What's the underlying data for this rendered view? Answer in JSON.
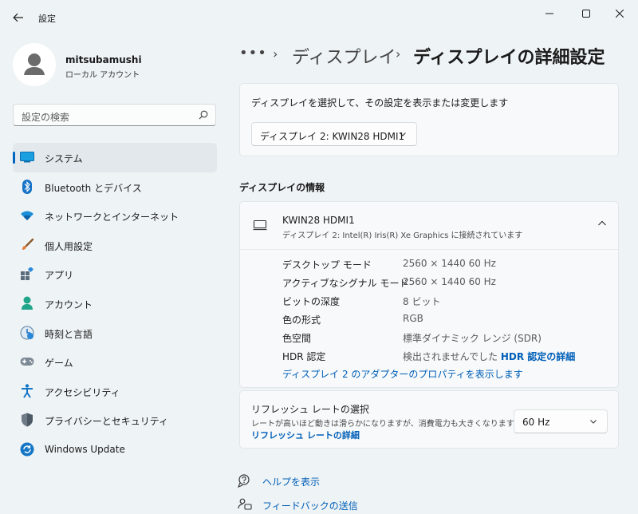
{
  "window": {
    "title": "設定"
  },
  "colors": {
    "accent": "#0067c0",
    "link": "#005fb8",
    "background": "#eef3f5",
    "card": "#f7f9fa"
  },
  "profile": {
    "name": "mitsubamushi",
    "account_type": "ローカル アカウント"
  },
  "search": {
    "placeholder": "設定の検索"
  },
  "sidebar": {
    "items": [
      {
        "label": "システム",
        "icon": "system-icon",
        "active": true
      },
      {
        "label": "Bluetooth とデバイス",
        "icon": "bluetooth-icon"
      },
      {
        "label": "ネットワークとインターネット",
        "icon": "wifi-icon"
      },
      {
        "label": "個人用設定",
        "icon": "brush-icon"
      },
      {
        "label": "アプリ",
        "icon": "apps-icon"
      },
      {
        "label": "アカウント",
        "icon": "account-icon"
      },
      {
        "label": "時刻と言語",
        "icon": "time-language-icon"
      },
      {
        "label": "ゲーム",
        "icon": "gamepad-icon"
      },
      {
        "label": "アクセシビリティ",
        "icon": "accessibility-icon"
      },
      {
        "label": "プライバシーとセキュリティ",
        "icon": "shield-icon"
      },
      {
        "label": "Windows Update",
        "icon": "update-icon"
      }
    ]
  },
  "breadcrumb": {
    "ellipsis": "•••",
    "parent": "ディスプレイ",
    "current": "ディスプレイの詳細設定"
  },
  "display_select": {
    "label": "ディスプレイを選択して、その設定を表示または変更します",
    "selected": "ディスプレイ 2: KWIN28 HDMI1"
  },
  "display_info": {
    "section_title": "ディスプレイの情報",
    "name": "KWIN28 HDMI1",
    "connection": "ディスプレイ 2: Intel(R) Iris(R) Xe Graphics に接続されています",
    "rows": [
      {
        "label": "デスクトップ モード",
        "value": "2560 × 1440 60 Hz"
      },
      {
        "label": "アクティブなシグナル モード",
        "value": "2560 × 1440 60 Hz"
      },
      {
        "label": "ビットの深度",
        "value": "8 ビット"
      },
      {
        "label": "色の形式",
        "value": "RGB"
      },
      {
        "label": "色空間",
        "value": "標準ダイナミック レンジ (SDR)"
      },
      {
        "label": "HDR 認定",
        "value": "検出されませんでした",
        "link": "HDR 認定の詳細"
      }
    ],
    "adapter_link": "ディスプレイ 2 のアダプターのプロパティを表示します"
  },
  "refresh_rate": {
    "title": "リフレッシュ レートの選択",
    "description": "レートが高いほど動きは滑らかになりますが、消費電力も大きくなります。",
    "link": "リフレッシュ レートの詳細",
    "selected": "60 Hz"
  },
  "footer": {
    "help": "ヘルプを表示",
    "feedback": "フィードバックの送信"
  }
}
